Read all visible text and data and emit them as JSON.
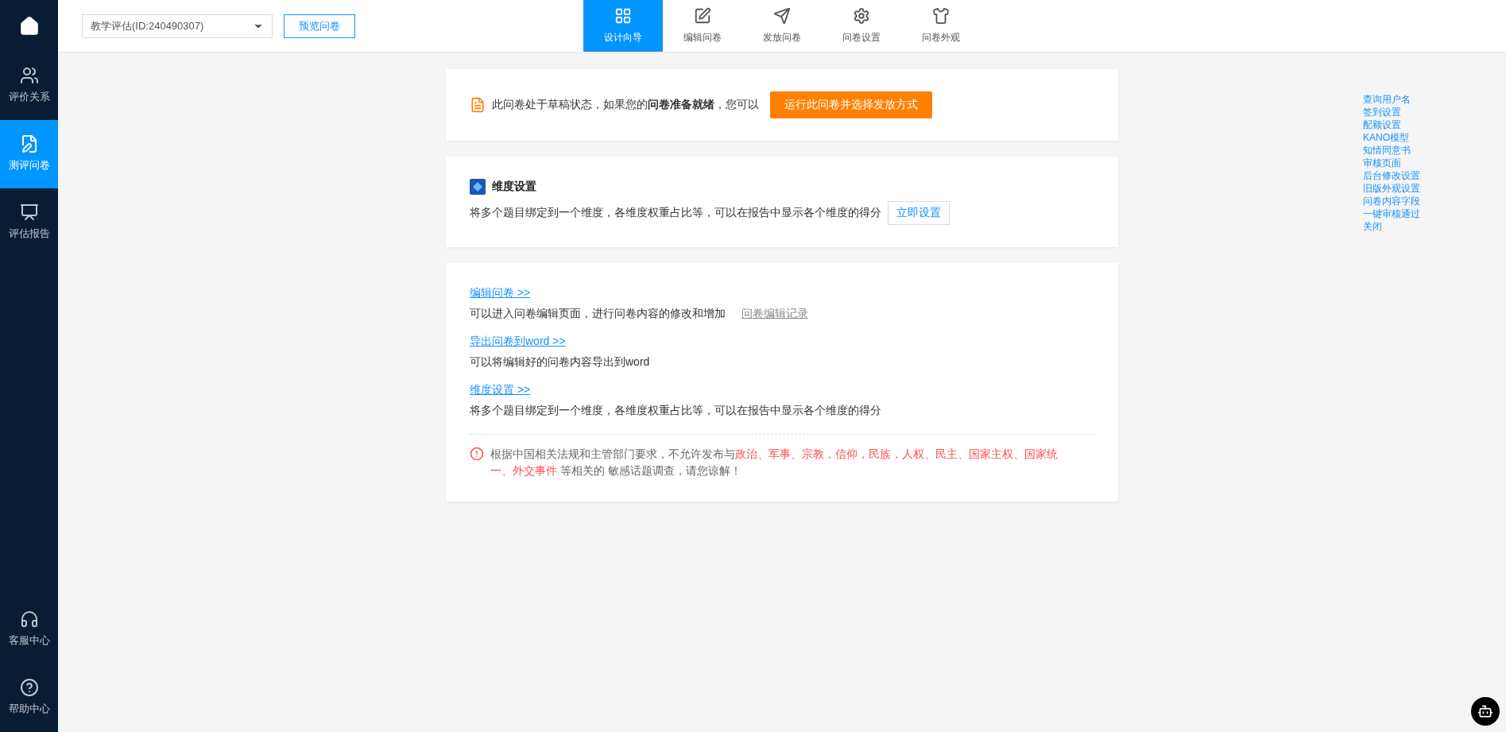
{
  "sidebar": {
    "items": [
      {
        "label": "评价关系",
        "selected": false
      },
      {
        "label": "测评问卷",
        "selected": true
      },
      {
        "label": "评估报告",
        "selected": false
      }
    ],
    "bottom_items": [
      {
        "label": "客服中心"
      },
      {
        "label": "帮助中心"
      }
    ]
  },
  "topbar": {
    "survey_select": {
      "value": "教学评估(ID:240490307)"
    },
    "preview_button": "预览问卷",
    "tabs": [
      {
        "label": "设计向导",
        "selected": true
      },
      {
        "label": "编辑问卷",
        "selected": false
      },
      {
        "label": "发放问卷",
        "selected": false
      },
      {
        "label": "问卷设置",
        "selected": false
      },
      {
        "label": "问卷外观",
        "selected": false
      }
    ]
  },
  "notice": {
    "text": "此问卷处于草稿状态，如果您的**问卷准备就绪**，您可以",
    "button": "运行此问卷并选择发放方式"
  },
  "dimension_card": {
    "title": "维度设置",
    "description": "将多个题目绑定到一个维度，各维度权重占比等，可以在报告中显示各个维度的得分",
    "button": "立即设置"
  },
  "links_card": {
    "sections": [
      {
        "link": "编辑问卷 >>",
        "description": "可以进入问卷编辑页面，进行问卷内容的修改和增加",
        "extra_link": "问卷编辑记录"
      },
      {
        "link": "导出问卷到word >>",
        "description": "可以将编辑好的问卷内容导出到word"
      },
      {
        "link": "维度设置 >>",
        "description": "将多个题目绑定到一个维度，各维度权重占比等，可以在报告中显示各个维度的得分"
      }
    ],
    "warning": [
      {
        "text": "根据中国相关法规和主管部门要求，不允许发布与",
        "highlight": false
      },
      {
        "text": "政治、军事、宗教，信仰，民族，人权、民主、国家主权、国家统一、外交事件",
        "highlight": true
      },
      {
        "text": " 等相关的 敏感话题调查，请您谅解！",
        "highlight": false
      }
    ]
  },
  "right_menu": [
    "查询用户名",
    "签到设置",
    "配额设置",
    "KANO模型",
    "知情同意书",
    "审核页面",
    "后台修改设置",
    "旧版外观设置",
    "问卷内容字段",
    "一键审核通过",
    "关闭"
  ]
}
